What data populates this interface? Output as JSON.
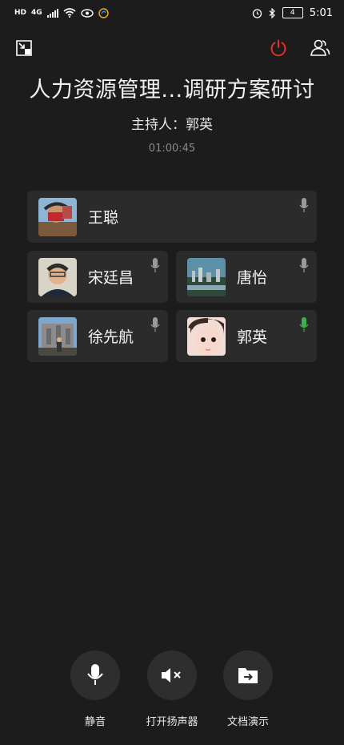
{
  "status_bar": {
    "hd": "HD",
    "network": "4G",
    "battery": "4",
    "time": "5:01"
  },
  "meeting": {
    "title": "人力资源管理...调研方案研讨",
    "host_label": "主持人：郭英",
    "timer": "01:00:45"
  },
  "participants": [
    {
      "name": "王聪",
      "mic_color": "#9a9a9a"
    },
    {
      "name": "宋廷昌",
      "mic_color": "#9a9a9a"
    },
    {
      "name": "唐怡",
      "mic_color": "#9a9a9a"
    },
    {
      "name": "徐先航",
      "mic_color": "#9a9a9a"
    },
    {
      "name": "郭英",
      "mic_color": "#3cb34a"
    }
  ],
  "controls": {
    "mute_label": "静音",
    "speaker_label": "打开扬声器",
    "share_label": "文档演示"
  },
  "colors": {
    "end_call": "#e0312b",
    "active_mic": "#3cb34a",
    "background": "#1c1c1c",
    "tile": "#2b2b2b"
  }
}
